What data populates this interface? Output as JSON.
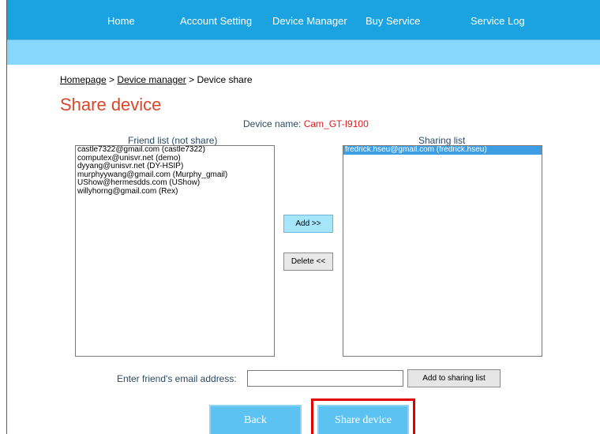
{
  "nav": {
    "items": [
      {
        "label": "Home"
      },
      {
        "label": "Account Setting"
      },
      {
        "label": "Device Manager"
      },
      {
        "label": "Buy Service"
      },
      {
        "label": "Service Log"
      }
    ]
  },
  "breadcrumb": {
    "home": "Homepage",
    "separator": " > ",
    "device_manager": "Device manager",
    "current": "Device share"
  },
  "page_title": "Share device",
  "device_name": {
    "label": "Device name: ",
    "value": "Cam_GT-I9100"
  },
  "friend_list": {
    "header": "Friend list (not share)",
    "items": [
      "castle7322@gmail.com (castle7322)",
      "computex@unisvr.net (demo)",
      "dyyang@unisvr.net (DY-HSIP)",
      "murphyywang@gmail.com (Murphy_gmail)",
      "UShow@hermesdds.com (UShow)",
      "willyhorng@gmail.com (Rex)"
    ]
  },
  "sharing_list": {
    "header": "Sharing list",
    "items": [
      "fredrick.hseu@gmail.com (fredrick.hseu)"
    ],
    "selected_index": 0
  },
  "buttons": {
    "add": "Add >>",
    "delete": "Delete <<",
    "add_to_sharing": "Add to sharing list",
    "back": "Back",
    "share_device": "Share device"
  },
  "email_entry": {
    "label": "Enter friend's email address:",
    "value": "",
    "placeholder": ""
  },
  "colors": {
    "nav_bg": "#1aa3e0",
    "subbar_bg": "#87d7fb",
    "title_red": "#d9472a",
    "device_value_red": "#e01b1b",
    "selected_bg": "#3d9ee4",
    "big_button_bg": "#5cc2f2",
    "highlight_border": "#e00000"
  }
}
